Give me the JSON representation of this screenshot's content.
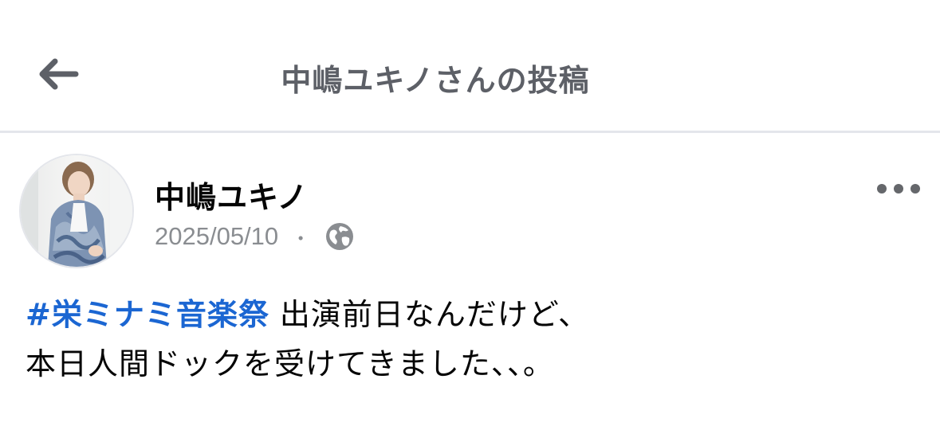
{
  "header": {
    "back_icon": "arrow-left-icon",
    "title": "中嶋ユキノさんの投稿"
  },
  "post": {
    "author": {
      "name": "中嶋ユキノ",
      "avatar": "profile-photo"
    },
    "date": "2025/05/10",
    "separator": "・",
    "privacy_icon": "globe-icon",
    "more_icon": "more-horizontal-icon",
    "body": {
      "hashtag": "#栄ミナミ音楽祭",
      "line1_text": " 出演前日なんだけど、",
      "line2_text": "本日人間ドックを受けてきました、、。"
    }
  },
  "colors": {
    "hashtag": "#1b66d2",
    "title": "#5d6067",
    "meta": "#8a8d91",
    "divider": "#e4e6eb"
  }
}
